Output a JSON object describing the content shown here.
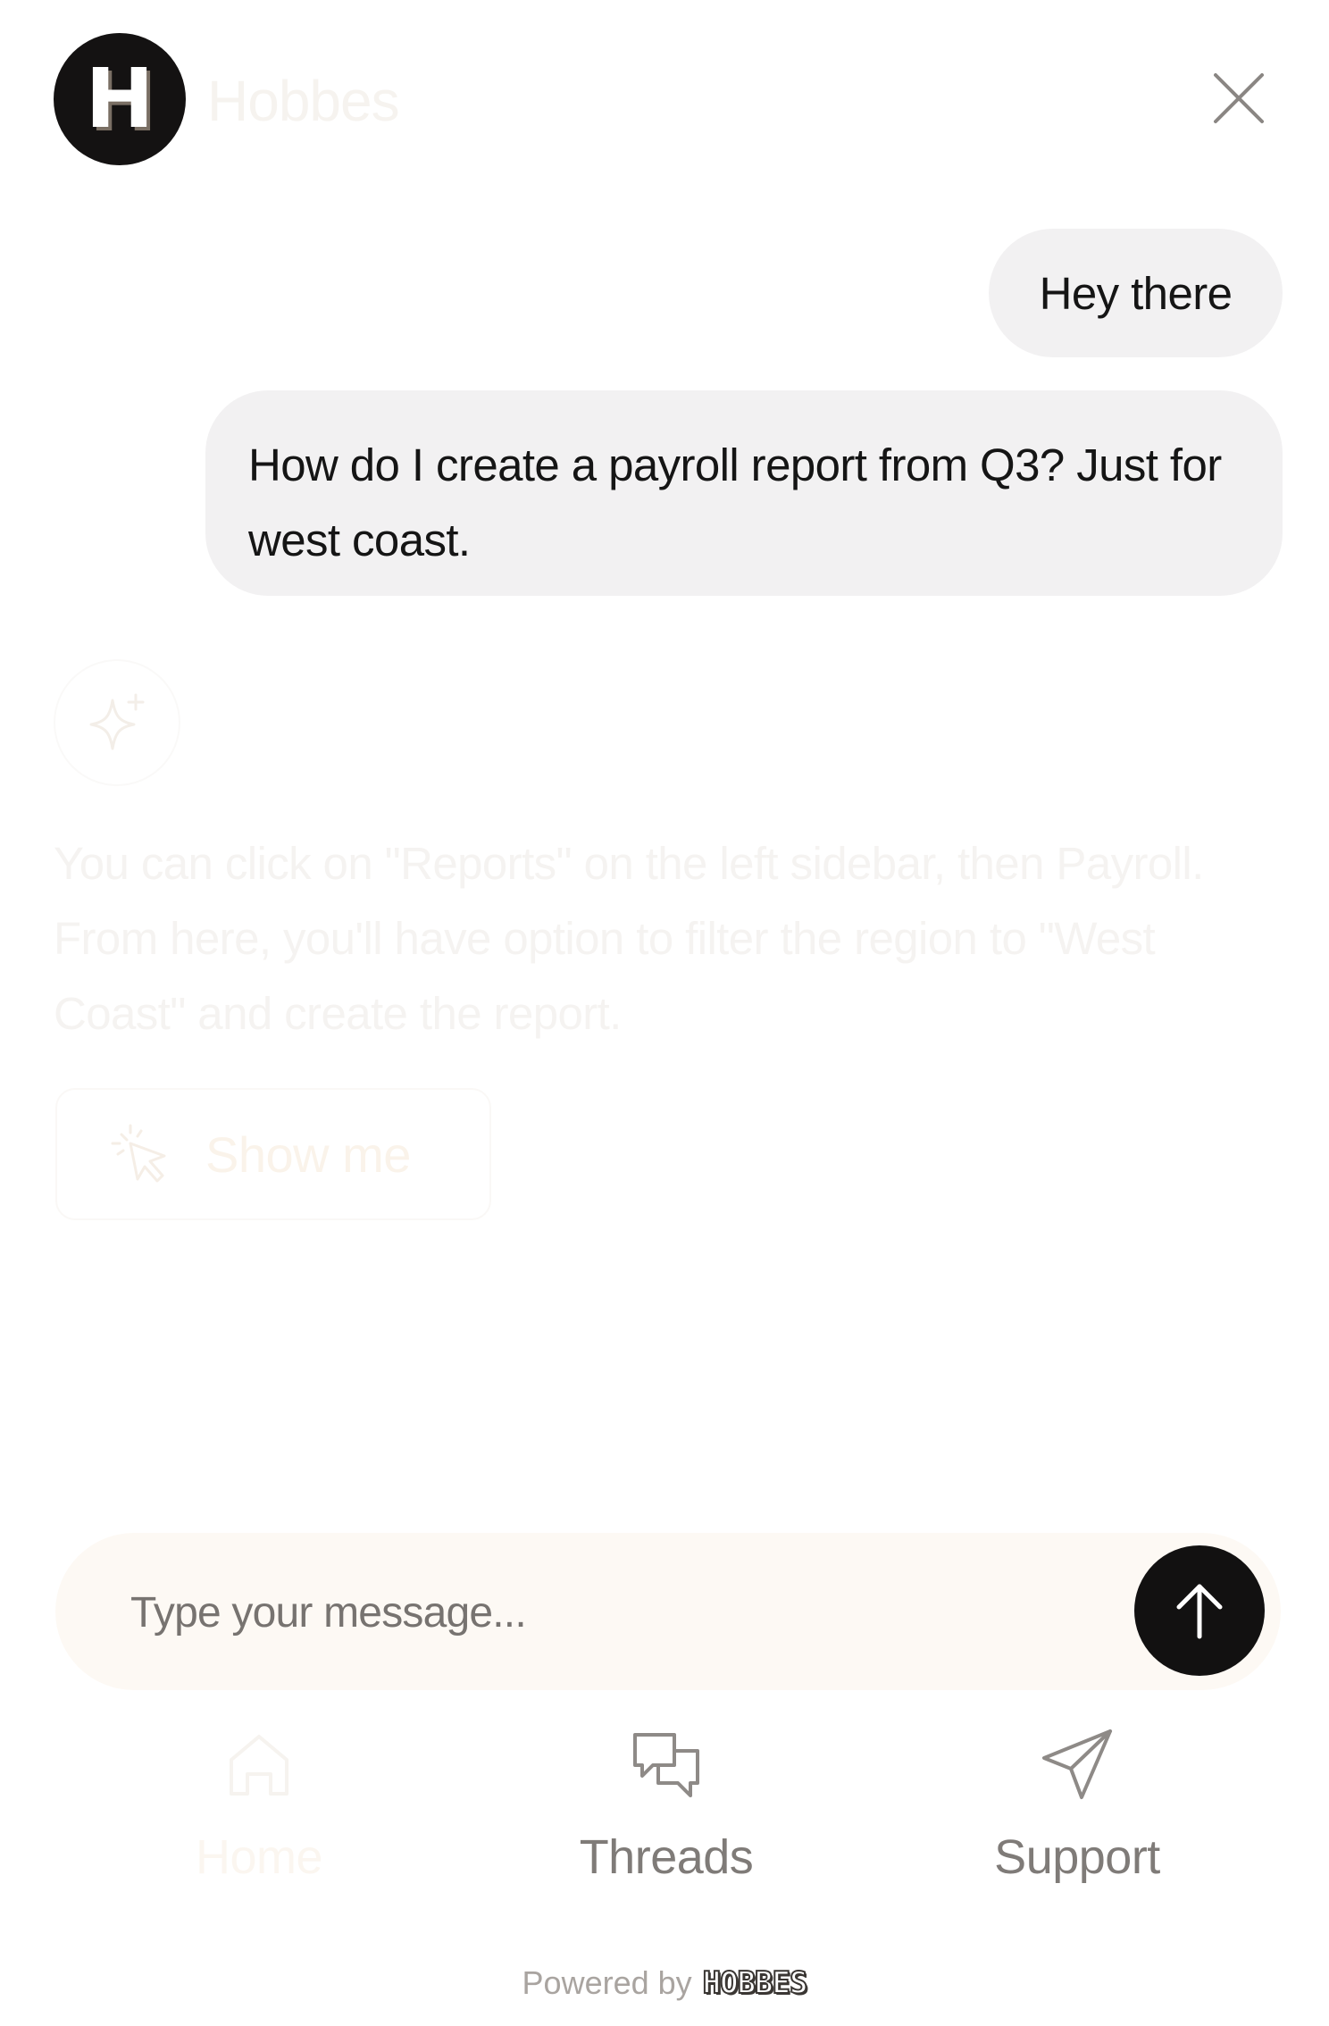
{
  "header": {
    "logo_letter": "H",
    "brand_name": "Hobbes"
  },
  "messages": {
    "user_1": "Hey there",
    "user_2": "How do I create a payroll report from Q3? Just for west coast.",
    "assistant": "You can click on \"Reports\" on the left sidebar, then Payroll. From here, you'll have option to filter the region to \"West Coast\" and create the report.",
    "show_me_label": "Show me"
  },
  "composer": {
    "value": "",
    "placeholder": "Type your message..."
  },
  "nav": {
    "home_label": "Home",
    "threads_label": "Threads",
    "support_label": "Support"
  },
  "footer": {
    "powered_by": "Powered by",
    "brand": "HOBBES"
  },
  "icons": {
    "close": "close-icon",
    "sparkle": "sparkle-icon",
    "cursor_click": "cursor-click-icon",
    "send": "arrow-up-icon",
    "home": "home-icon",
    "threads": "chat-bubbles-icon",
    "support": "paper-plane-icon"
  },
  "colors": {
    "accent": "#121111",
    "bubble": "#f2f1f2",
    "composer_bg": "#fdf9f4"
  }
}
